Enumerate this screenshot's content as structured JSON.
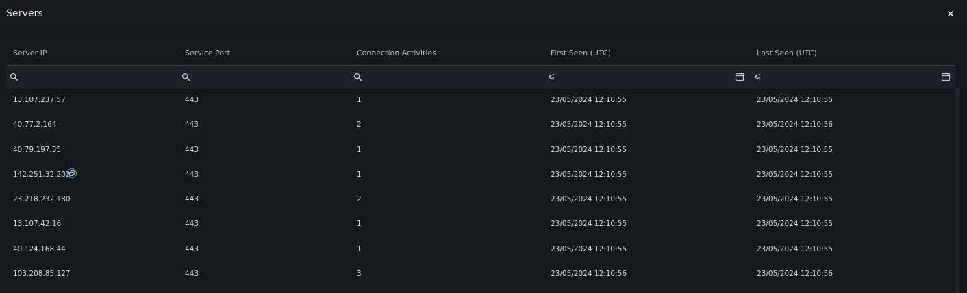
{
  "dialog": {
    "title": "Servers",
    "close_label": "×"
  },
  "table": {
    "columns": [
      "Server IP",
      "Service Port",
      "Connection Activities",
      "First Seen (UTC)",
      "Last Seen (UTC)"
    ],
    "filters": {
      "server_ip": "",
      "service_port": "",
      "connection_activities": "",
      "first_seen_operator": "⩽",
      "last_seen_operator": "⩽"
    },
    "rows": [
      [
        "13.107.237.57",
        "443",
        "1",
        "23/05/2024 12:10:55",
        "23/05/2024 12:10:55"
      ],
      [
        "40.77.2.164",
        "443",
        "2",
        "23/05/2024 12:10:55",
        "23/05/2024 12:10:56"
      ],
      [
        "40.79.197.35",
        "443",
        "1",
        "23/05/2024 12:10:55",
        "23/05/2024 12:10:55"
      ],
      [
        "142.251.32.202",
        "443",
        "1",
        "23/05/2024 12:10:55",
        "23/05/2024 12:10:55"
      ],
      [
        "23.218.232.180",
        "443",
        "2",
        "23/05/2024 12:10:55",
        "23/05/2024 12:10:55"
      ],
      [
        "13.107.42.16",
        "443",
        "1",
        "23/05/2024 12:10:55",
        "23/05/2024 12:10:55"
      ],
      [
        "40.124.168.44",
        "443",
        "1",
        "23/05/2024 12:10:55",
        "23/05/2024 12:10:55"
      ],
      [
        "103.208.85.127",
        "443",
        "3",
        "23/05/2024 12:10:56",
        "23/05/2024 12:10:56"
      ]
    ]
  },
  "icons": {
    "filter": "search-icon",
    "date": "calendar-icon",
    "copy": "copy-icon",
    "close": "close-icon"
  },
  "colors": {
    "background": "#16181c",
    "filter_background": "#1e2126",
    "accent": "#4d8fd6"
  }
}
